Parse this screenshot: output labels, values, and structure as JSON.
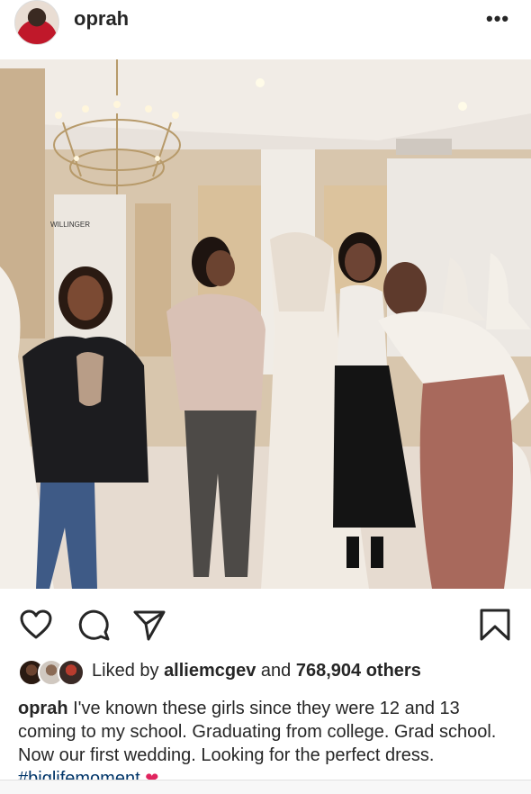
{
  "header": {
    "username": "oprah",
    "more_label": "•••"
  },
  "photo": {
    "store_sign": "WILLINGER"
  },
  "actions": {
    "like_icon": "heart-outline-icon",
    "comment_icon": "comment-bubble-icon",
    "share_icon": "paper-plane-icon",
    "save_icon": "bookmark-icon"
  },
  "likes": {
    "prefix": "Liked by",
    "user": "alliemcgev",
    "middle": "and",
    "others": "768,904 others"
  },
  "caption": {
    "user": "oprah",
    "text": "I've known these girls since they were 12 and 13 coming to my school. Graduating from college. Grad school. Now our first wedding. Looking for the perfect dress.",
    "hashtag": "#biglifemoment",
    "emoji": "❤"
  },
  "colors": {
    "text": "#262626",
    "hashtag": "#003569",
    "heart_emoji": "#e0245e"
  }
}
